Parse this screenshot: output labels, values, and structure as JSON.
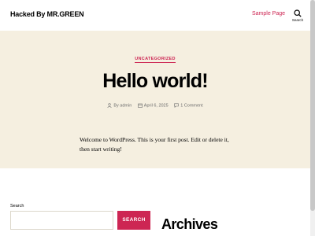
{
  "header": {
    "site_title": "Hacked By MR.GREEN",
    "nav_items": [
      "Sample Page"
    ],
    "search_label": "Search"
  },
  "post": {
    "category": "UNCATEGORIZED",
    "title": "Hello world!",
    "author": "By admin",
    "date": "April 6, 2025",
    "comments": "1 Comment",
    "content": "Welcome to WordPress. This is your first post. Edit or delete it, then start writing!"
  },
  "widgets": {
    "search_label": "Search",
    "search_value": "",
    "search_button": "SEARCH",
    "archives_heading": "Archives"
  },
  "colors": {
    "accent": "#cd2653",
    "hero_bg": "#f5efe0",
    "meta_text": "#6d6d6d"
  }
}
